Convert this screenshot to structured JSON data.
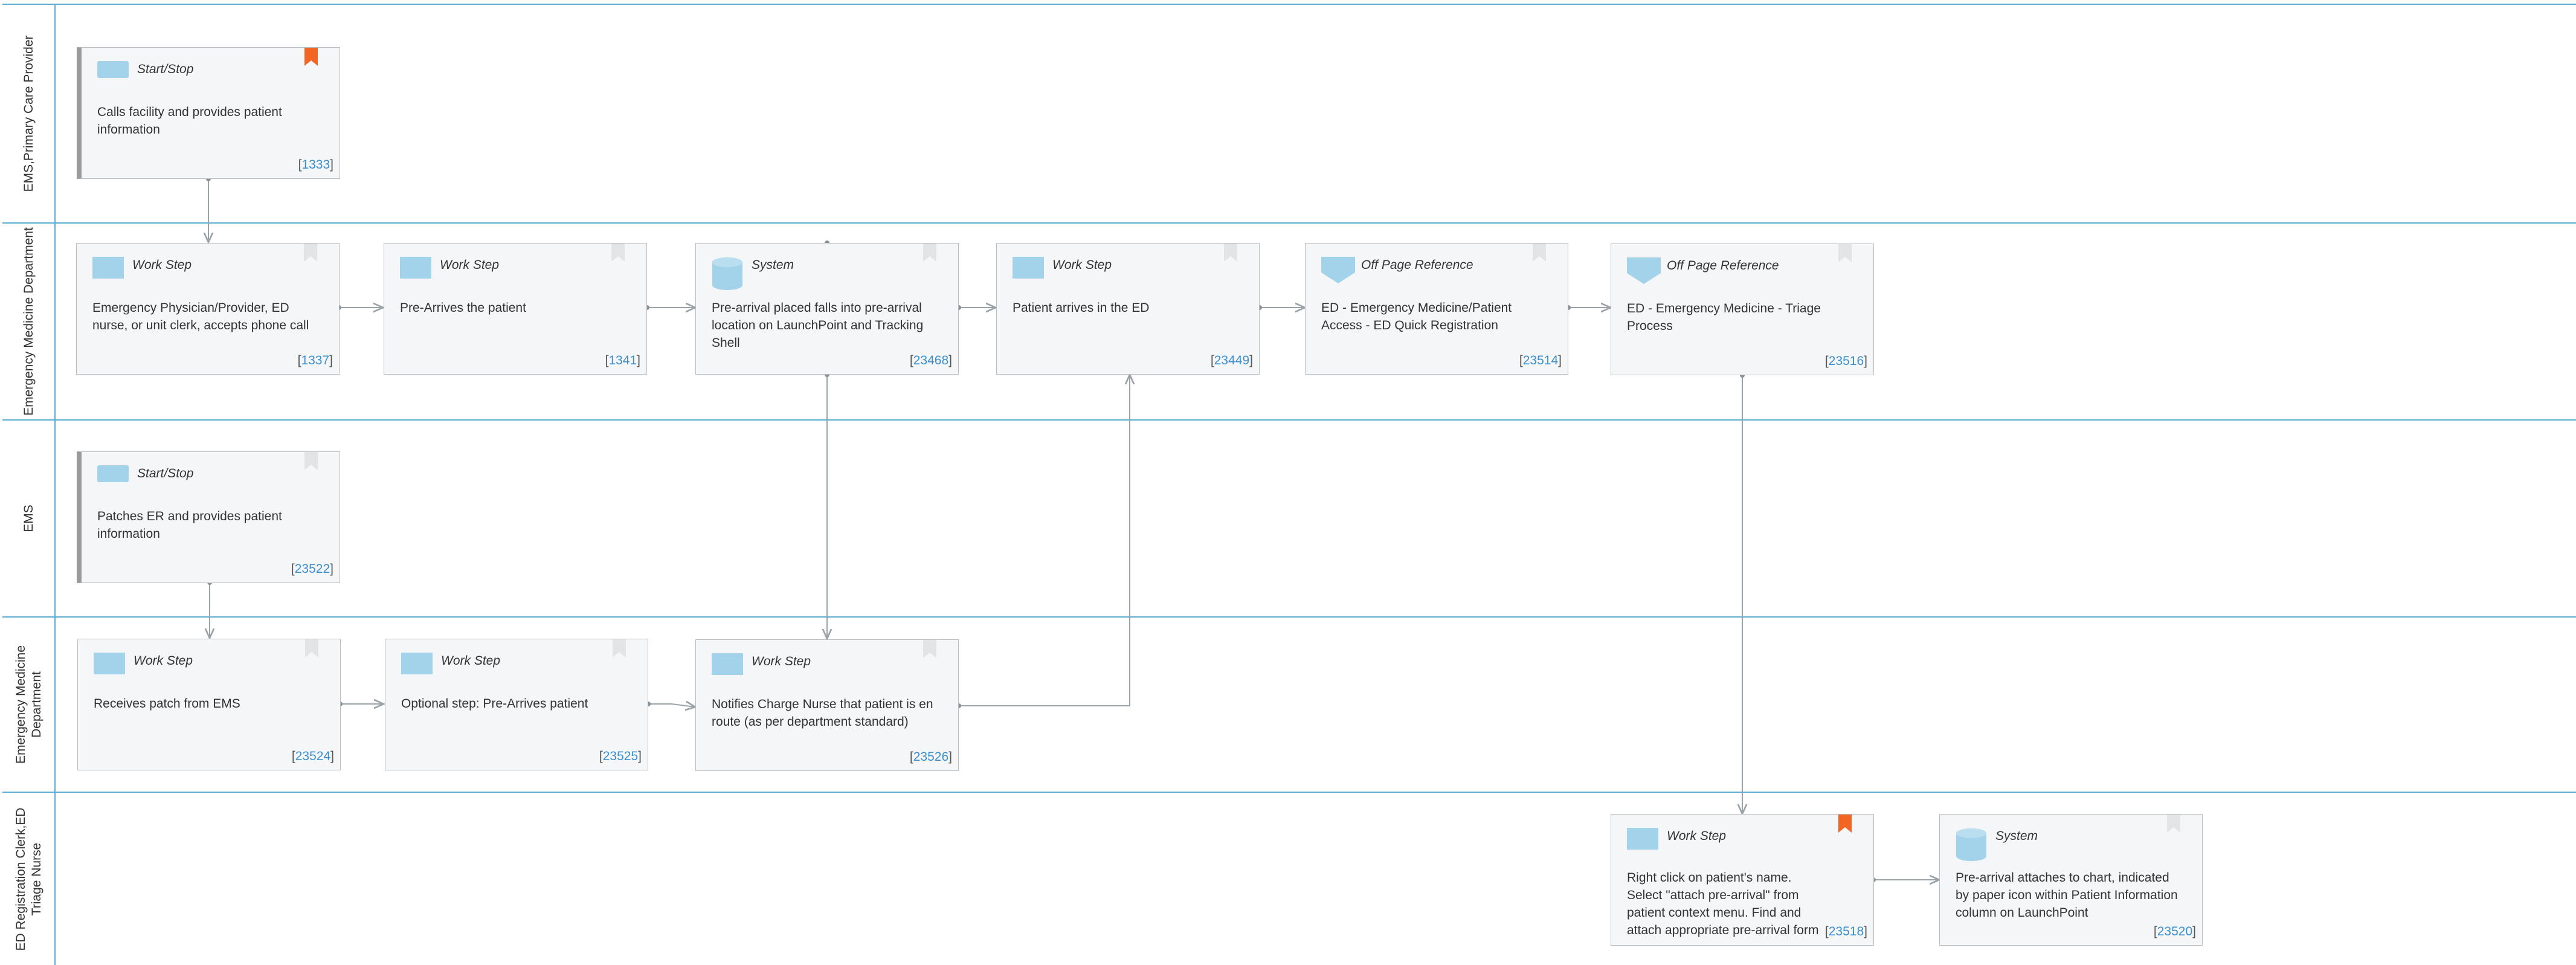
{
  "lanes": [
    {
      "label": "EMS,Primary Care Provider"
    },
    {
      "label": "Emergency Medicine Department"
    },
    {
      "label": "EMS"
    },
    {
      "label": "Emergency Medicine Department"
    },
    {
      "label": "ED Registration Clerk,ED Triage Nurse"
    }
  ],
  "steps": [
    {
      "type": "Start/Stop",
      "icon": "start-stop-icon",
      "text": "Calls facility and provides patient information",
      "ref": "1333",
      "bookmark": "active"
    },
    {
      "type": "Work Step",
      "icon": "work-step-icon",
      "text": "Emergency Physician/Provider, ED nurse, or unit clerk, accepts phone call",
      "ref": "1337",
      "bookmark": "inactive"
    },
    {
      "type": "Work Step",
      "icon": "work-step-icon",
      "text": "Pre-Arrives the patient",
      "ref": "1341",
      "bookmark": "inactive"
    },
    {
      "type": "System",
      "icon": "database-icon",
      "text": "Pre-arrival placed falls into pre-arrival location on LaunchPoint and Tracking Shell",
      "ref": "23468",
      "bookmark": "inactive"
    },
    {
      "type": "Work Step",
      "icon": "work-step-icon",
      "text": "Patient arrives in the ED",
      "ref": "23449",
      "bookmark": "inactive"
    },
    {
      "type": "Off Page Reference",
      "icon": "off-page-reference-icon",
      "text": "ED - Emergency Medicine/Patient Access - ED Quick Registration",
      "ref": "23514",
      "bookmark": "inactive"
    },
    {
      "type": "Off Page Reference",
      "icon": "off-page-reference-icon",
      "text": "ED - Emergency Medicine - Triage Process",
      "ref": "23516",
      "bookmark": "inactive"
    },
    {
      "type": "Start/Stop",
      "icon": "start-stop-icon",
      "text": "Patches ER and provides patient information",
      "ref": "23522",
      "bookmark": "inactive"
    },
    {
      "type": "Work Step",
      "icon": "work-step-icon",
      "text": "Receives patch from EMS",
      "ref": "23524",
      "bookmark": "inactive"
    },
    {
      "type": "Work Step",
      "icon": "work-step-icon",
      "text": "Optional step: Pre-Arrives patient",
      "ref": "23525",
      "bookmark": "inactive"
    },
    {
      "type": "Work Step",
      "icon": "work-step-icon",
      "text": "Notifies Charge Nurse that patient is en route (as per department standard)",
      "ref": "23526",
      "bookmark": "inactive"
    },
    {
      "type": "Work Step",
      "icon": "work-step-icon",
      "text": "Right click on patient's name. Select \"attach pre-arrival\" from patient context menu. Find and attach appropriate pre-arrival form",
      "ref": "23518",
      "bookmark": "active"
    },
    {
      "type": "System",
      "icon": "database-icon",
      "text": "Pre-arrival attaches to chart, indicated by paper icon within Patient Information column on LaunchPoint",
      "ref": "23520",
      "bookmark": "inactive"
    }
  ],
  "connectors": [
    {
      "from": "1333",
      "to": "1337"
    },
    {
      "from": "1337",
      "to": "1341"
    },
    {
      "from": "1341",
      "to": "23468"
    },
    {
      "from": "23468",
      "to": "23449"
    },
    {
      "from": "23449",
      "to": "23514"
    },
    {
      "from": "23514",
      "to": "23516"
    },
    {
      "from": "23468",
      "to": "23526"
    },
    {
      "from": "23522",
      "to": "23524"
    },
    {
      "from": "23524",
      "to": "23525"
    },
    {
      "from": "23525",
      "to": "23526"
    },
    {
      "from": "23526",
      "to": "23449"
    },
    {
      "from": "23516",
      "to": "23518"
    },
    {
      "from": "23518",
      "to": "23520"
    }
  ],
  "colors": {
    "lane_border": "#5aaed0",
    "icon_fill": "#a3d3ea",
    "bookmark_active": "#f26522",
    "bookmark_inactive": "#e2e4e6",
    "ref_text": "#3b8fcf",
    "connector": "#9aa3a8"
  }
}
